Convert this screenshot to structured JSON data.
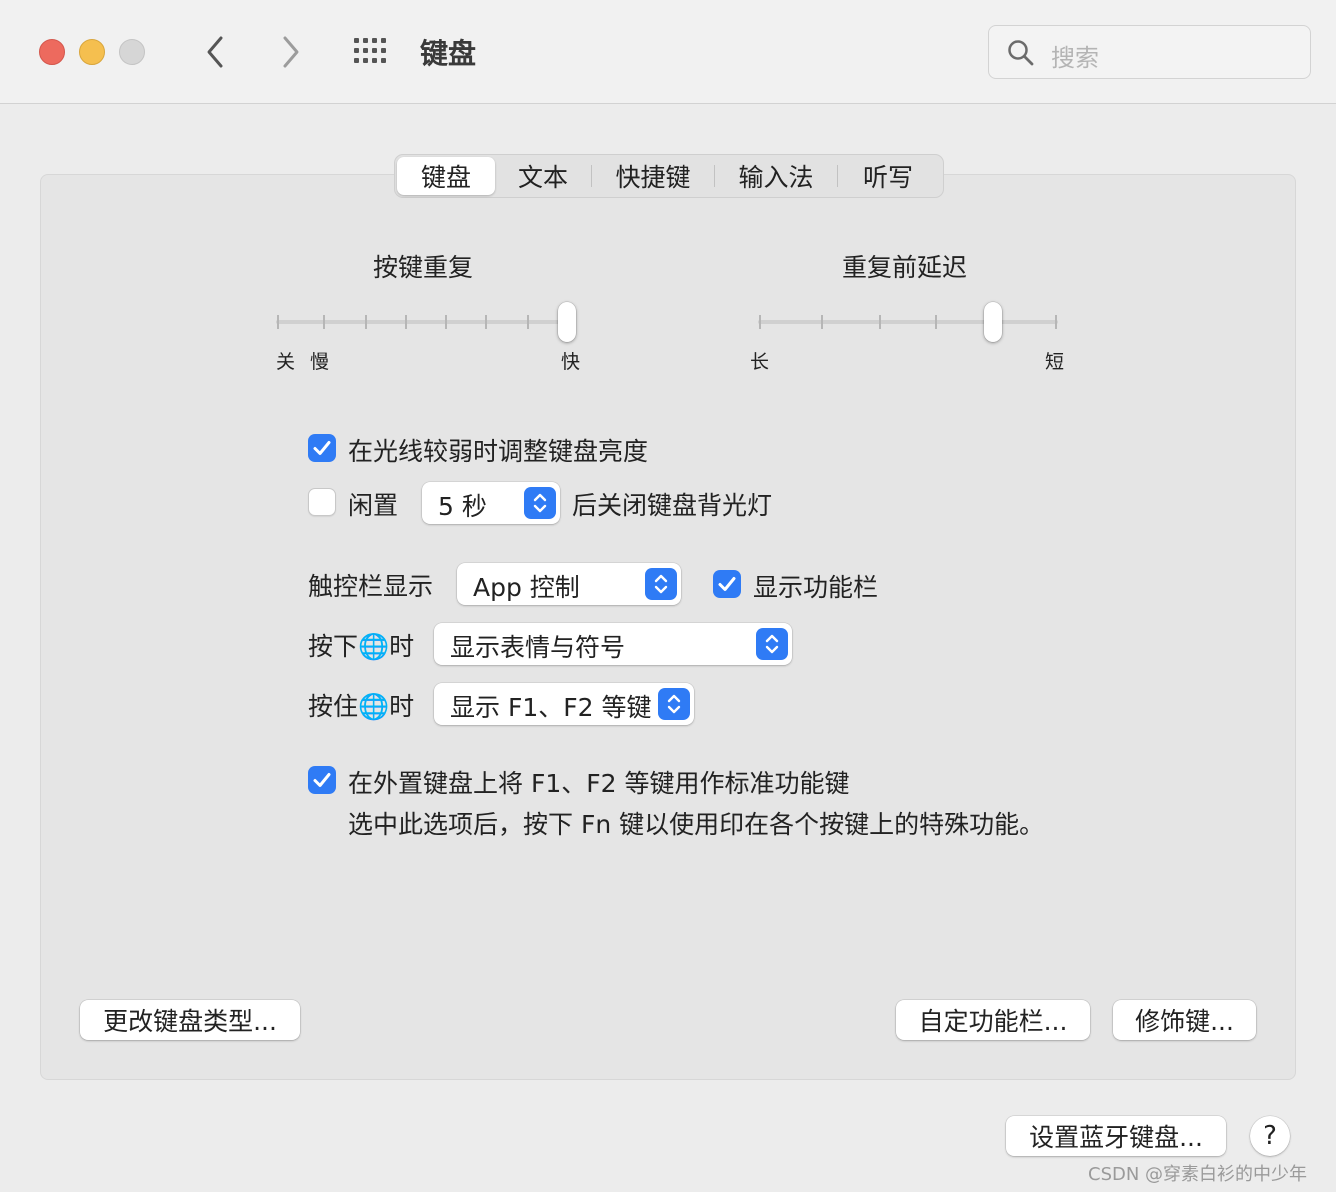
{
  "window": {
    "title": "键盘",
    "search_placeholder": "搜索"
  },
  "tabs": [
    {
      "label": "键盘",
      "active": true
    },
    {
      "label": "文本",
      "active": false
    },
    {
      "label": "快捷键",
      "active": false
    },
    {
      "label": "输入法",
      "active": false
    },
    {
      "label": "听写",
      "active": false
    }
  ],
  "key_repeat": {
    "title": "按键重复",
    "label_off": "关",
    "label_slow": "慢",
    "label_fast": "快",
    "level_fraction": 1.0
  },
  "delay_until_repeat": {
    "title": "重复前延迟",
    "label_long": "长",
    "label_short": "短",
    "level_fraction": 0.8
  },
  "options": {
    "adjust_brightness": {
      "label": "在光线较弱时调整键盘亮度",
      "checked": true
    },
    "idle_backlight": {
      "prefix": "闲置",
      "value": "5 秒",
      "suffix": "后关闭键盘背光灯",
      "checked": false
    },
    "touch_bar": {
      "label": "触控栏显示",
      "value": "App 控制"
    },
    "show_function_bar": {
      "label": "显示功能栏",
      "checked": true
    },
    "press_globe": {
      "label": "按下🌐时",
      "value": "显示表情与符号"
    },
    "hold_globe": {
      "label": "按住🌐时",
      "value": "显示 F1、F2 等键"
    },
    "standard_function_keys": {
      "label": "在外置键盘上将 F1、F2 等键用作标准功能键",
      "description": "选中此选项后，按下 Fn 键以使用印在各个按键上的特殊功能。",
      "checked": true
    }
  },
  "buttons": {
    "change_keyboard_type": "更改键盘类型...",
    "customize_control_strip": "自定功能栏...",
    "modifier_keys": "修饰键...",
    "setup_bluetooth": "设置蓝牙键盘...",
    "help": "?"
  },
  "watermark": "CSDN @穿素白衫的中少年",
  "colors": {
    "accent": "#2f7bf5",
    "close": "#ed6a5e",
    "minimize": "#f5bf4f",
    "zoom_disabled": "#d6d6d6"
  }
}
